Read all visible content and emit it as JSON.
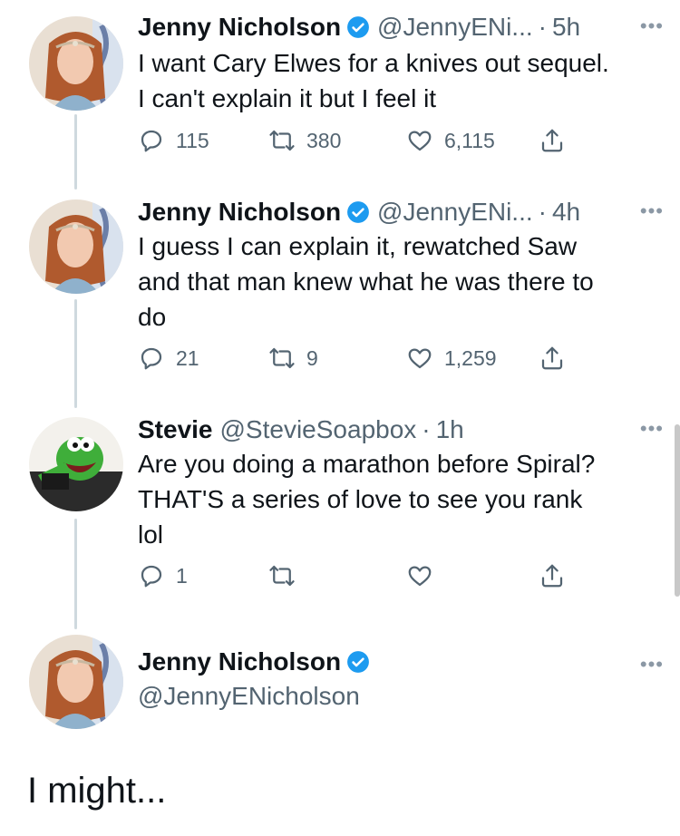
{
  "tweets": [
    {
      "name": "Jenny Nicholson",
      "handle": "@JennyENi...",
      "time": "5h",
      "text_lines": [
        "I want Cary Elwes for a knives out sequel.",
        "I can't explain it but I feel it"
      ],
      "replies": "115",
      "retweets": "380",
      "likes": "6,115"
    },
    {
      "name": "Jenny Nicholson",
      "handle": "@JennyENi...",
      "time": "4h",
      "text_lines": [
        "I guess I can explain it, rewatched Saw",
        "and that man knew what he was there to",
        "do"
      ],
      "replies": "21",
      "retweets": "9",
      "likes": "1,259"
    },
    {
      "name": "Stevie",
      "handle": "@StevieSoapbox",
      "time": "1h",
      "text_lines": [
        "Are you doing a marathon before Spiral?",
        "THAT'S a series of love to see you rank",
        "lol"
      ],
      "replies": "1",
      "retweets": "",
      "likes": ""
    }
  ],
  "reply_author": {
    "name": "Jenny Nicholson",
    "handle": "@JennyENicholson"
  },
  "reply_text": "I might...",
  "dot": "·",
  "more": "•••",
  "colors": {
    "verified": "#1d9bf0",
    "thread_line": "#cfd9de",
    "muted": "#536471"
  },
  "icons": [
    "reply-icon",
    "retweet-icon",
    "like-icon",
    "share-icon",
    "verified-badge-icon",
    "more-icon"
  ]
}
